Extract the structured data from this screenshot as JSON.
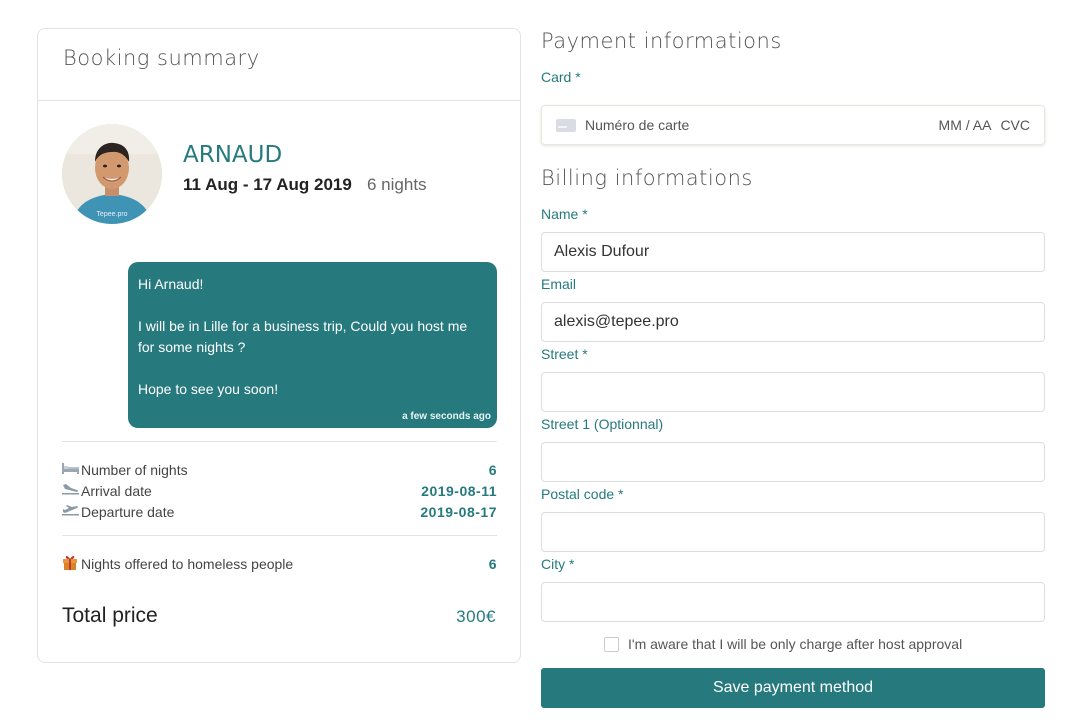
{
  "booking": {
    "title": "Booking summary",
    "guest_name": "ARNAUD",
    "dates": "11 Aug - 17 Aug 2019",
    "nights": "6 nights",
    "avatar_watermark": "Tepee.pro",
    "message": {
      "greeting": "Hi Arnaud!",
      "body": "I will be in Lille for a business trip, Could you host me for some nights ?",
      "closing": "Hope to see you soon!",
      "time": "a few seconds ago"
    },
    "details": [
      {
        "icon": "bed-icon",
        "label": "Number of nights",
        "value": "6"
      },
      {
        "icon": "plane-arrival-icon",
        "label": "Arrival date",
        "value": "2019-08-11"
      },
      {
        "icon": "plane-departure-icon",
        "label": "Departure date",
        "value": "2019-08-17"
      }
    ],
    "offered": {
      "icon": "gift-icon",
      "label": "Nights offered to homeless people",
      "value": "6"
    },
    "total": {
      "label": "Total price",
      "value": "300€"
    }
  },
  "payment": {
    "title": "Payment informations",
    "card_label": "Card *",
    "card_number_placeholder": "Numéro de carte",
    "card_expiry_placeholder": "MM / AA",
    "card_cvc_placeholder": "CVC"
  },
  "billing": {
    "title": "Billing informations",
    "name_label": "Name *",
    "name_value": "Alexis Dufour",
    "email_label": "Email",
    "email_value": "alexis@tepee.pro",
    "street_label": "Street *",
    "street_value": "",
    "street1_label": "Street 1 (Optionnal)",
    "street1_value": "",
    "postal_label": "Postal code *",
    "postal_value": "",
    "city_label": "City *",
    "city_value": "",
    "consent_label": "I'm aware that I will be only charge after host approval",
    "consent_checked": false,
    "save_label": "Save payment method"
  },
  "colors": {
    "accent": "#267a7e",
    "border": "#e3e3e3"
  }
}
